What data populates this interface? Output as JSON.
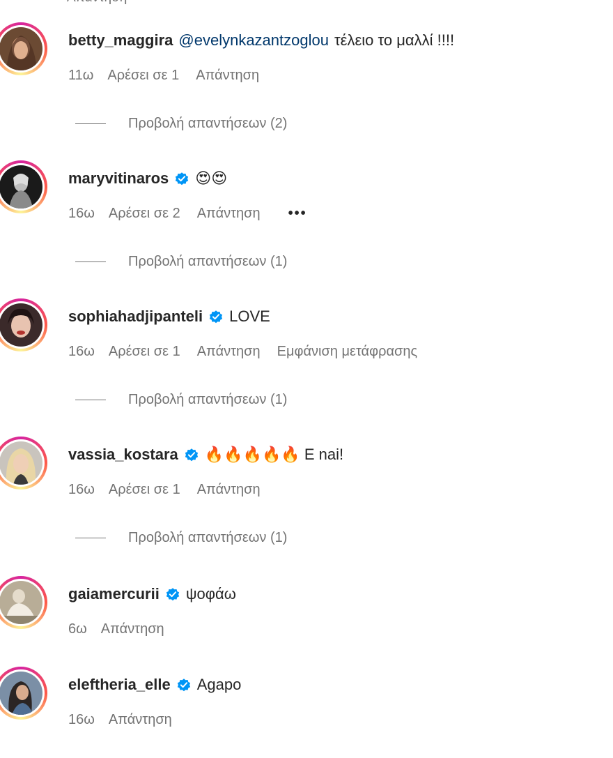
{
  "top_partial": "Απάντηση",
  "comments": [
    {
      "username": "betty_maggira",
      "verified": false,
      "mention": "@evelynkazantzoglou",
      "text": "τέλειο το μαλλί !!!!",
      "time": "11ω",
      "likes": "Αρέσει σε 1",
      "reply": "Απάντηση",
      "view_replies": "Προβολή απαντήσεων (2)"
    },
    {
      "username": "maryvitinaros",
      "verified": true,
      "text": "😍😍",
      "time": "16ω",
      "likes": "Αρέσει σε 2",
      "reply": "Απάντηση",
      "more": "•••",
      "view_replies": "Προβολή απαντήσεων (1)"
    },
    {
      "username": "sophiahadjipanteli",
      "verified": true,
      "text": "LOVE",
      "time": "16ω",
      "likes": "Αρέσει σε 1",
      "reply": "Απάντηση",
      "translate": "Εμφάνιση μετάφρασης",
      "view_replies": "Προβολή απαντήσεων (1)"
    },
    {
      "username": "vassia_kostara",
      "verified": true,
      "text": "🔥🔥🔥🔥🔥 E nai!",
      "time": "16ω",
      "likes": "Αρέσει σε 1",
      "reply": "Απάντηση",
      "view_replies": "Προβολή απαντήσεων (1)"
    },
    {
      "username": "gaiamercurii",
      "verified": true,
      "text": "ψοφάω",
      "time": "6ω",
      "reply": "Απάντηση"
    },
    {
      "username": "eleftheria_elle",
      "verified": true,
      "text": "Agapo",
      "time": "16ω",
      "reply": "Απάντηση"
    }
  ],
  "colors": {
    "username": "#262626",
    "meta": "#737373",
    "mention": "#00376b",
    "verified": "#0095f6"
  }
}
